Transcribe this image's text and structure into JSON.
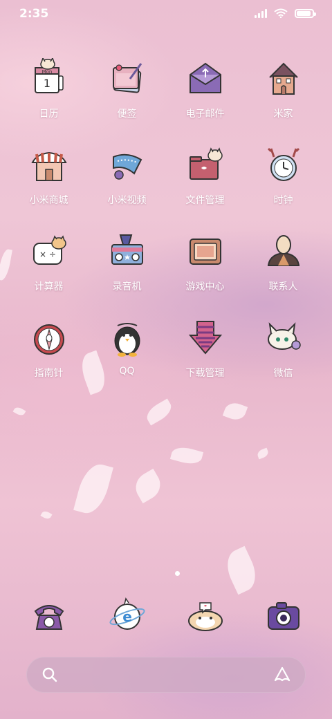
{
  "status_bar": {
    "time": "2:35",
    "battery_level": 0.9
  },
  "apps": [
    {
      "label": "日历",
      "icon": "calendar-icon",
      "calendar_month": "Mon",
      "calendar_day": "1"
    },
    {
      "label": "便签",
      "icon": "notes-icon"
    },
    {
      "label": "电子邮件",
      "icon": "email-icon"
    },
    {
      "label": "米家",
      "icon": "mi-home-icon"
    },
    {
      "label": "小米商城",
      "icon": "mi-store-icon"
    },
    {
      "label": "小米视频",
      "icon": "mi-video-icon"
    },
    {
      "label": "文件管理",
      "icon": "file-manager-icon"
    },
    {
      "label": "时钟",
      "icon": "clock-icon"
    },
    {
      "label": "计算器",
      "icon": "calculator-icon"
    },
    {
      "label": "录音机",
      "icon": "recorder-icon"
    },
    {
      "label": "游戏中心",
      "icon": "game-center-icon"
    },
    {
      "label": "联系人",
      "icon": "contacts-icon"
    },
    {
      "label": "指南针",
      "icon": "compass-icon"
    },
    {
      "label": "QQ",
      "icon": "qq-icon"
    },
    {
      "label": "下载管理",
      "icon": "download-manager-icon"
    },
    {
      "label": "微信",
      "icon": "wechat-icon"
    }
  ],
  "dock": [
    {
      "icon": "phone-icon"
    },
    {
      "icon": "browser-icon"
    },
    {
      "icon": "messages-icon"
    },
    {
      "icon": "camera-icon"
    }
  ],
  "page_indicator": {
    "current": 1,
    "total": 1
  },
  "search_bar": {
    "icon": "search-icon",
    "assistant_icon": "assistant-icon"
  }
}
